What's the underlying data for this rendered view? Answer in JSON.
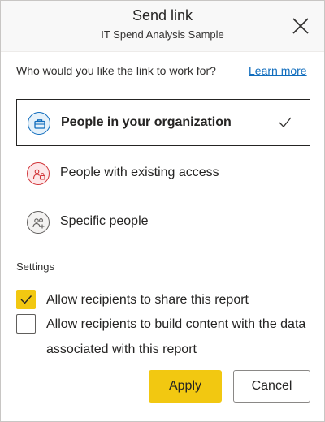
{
  "header": {
    "title": "Send link",
    "subtitle": "IT Spend Analysis Sample"
  },
  "prompt": {
    "question": "Who would you like the link to work for?",
    "learn_more": "Learn more"
  },
  "options": [
    {
      "label": "People in your organization",
      "icon": "briefcase-icon",
      "selected": true
    },
    {
      "label": "People with existing access",
      "icon": "people-lock-icon",
      "selected": false
    },
    {
      "label": "Specific people",
      "icon": "people-add-icon",
      "selected": false
    }
  ],
  "settings": {
    "label": "Settings",
    "items": [
      {
        "label": "Allow recipients to share this report",
        "checked": true
      },
      {
        "label": "Allow recipients to build content with the data associated with this report",
        "checked": false
      }
    ]
  },
  "buttons": {
    "apply": "Apply",
    "cancel": "Cancel"
  },
  "colors": {
    "accent_yellow": "#f2c811",
    "link_blue": "#0f6cbd",
    "org_icon": "#0f6cbd",
    "existing_icon": "#d13438",
    "specific_icon": "#605e5c"
  }
}
